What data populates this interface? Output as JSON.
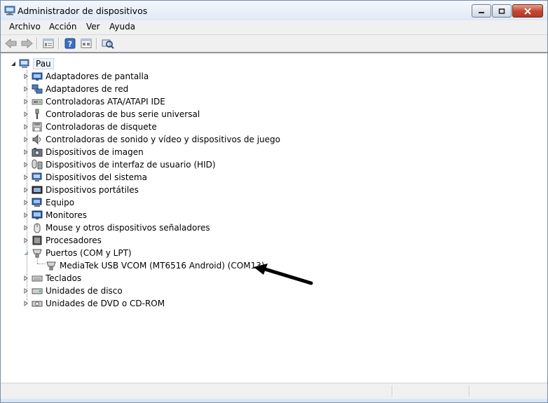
{
  "window": {
    "title": "Administrador de dispositivos",
    "controls": [
      "minimize",
      "maximize",
      "close"
    ]
  },
  "menu": [
    {
      "label": "Archivo"
    },
    {
      "label": "Acción"
    },
    {
      "label": "Ver"
    },
    {
      "label": "Ayuda"
    }
  ],
  "toolbar": {
    "icons": [
      "back-icon",
      "forward-icon",
      "properties-icon",
      "help-icon",
      "view-icon",
      "scan-hardware-icon"
    ]
  },
  "tree": {
    "root": {
      "label": "Pau",
      "expanded": true
    },
    "categories": [
      {
        "label": "Adaptadores de pantalla",
        "icon": "display-adapter-icon"
      },
      {
        "label": "Adaptadores de red",
        "icon": "network-adapter-icon"
      },
      {
        "label": "Controladoras ATA/ATAPI IDE",
        "icon": "ide-controller-icon"
      },
      {
        "label": "Controladoras de bus serie universal",
        "icon": "usb-icon"
      },
      {
        "label": "Controladoras de disquete",
        "icon": "floppy-icon"
      },
      {
        "label": "Controladoras de sonido y vídeo y dispositivos de juego",
        "icon": "sound-icon"
      },
      {
        "label": "Dispositivos de imagen",
        "icon": "camera-icon"
      },
      {
        "label": "Dispositivos de interfaz de usuario (HID)",
        "icon": "hid-icon"
      },
      {
        "label": "Dispositivos del sistema",
        "icon": "system-device-icon"
      },
      {
        "label": "Dispositivos portátiles",
        "icon": "portable-device-icon"
      },
      {
        "label": "Equipo",
        "icon": "computer-icon"
      },
      {
        "label": "Monitores",
        "icon": "monitor-icon"
      },
      {
        "label": "Mouse y otros dispositivos señaladores",
        "icon": "mouse-icon"
      },
      {
        "label": "Procesadores",
        "icon": "processor-icon"
      },
      {
        "label": "Puertos (COM y LPT)",
        "icon": "port-icon",
        "expanded": true,
        "children": [
          {
            "label": "MediaTek USB VCOM (MT6516 Android) (COM13)",
            "icon": "port-icon"
          }
        ]
      },
      {
        "label": "Teclados",
        "icon": "keyboard-icon"
      },
      {
        "label": "Unidades de disco",
        "icon": "disk-icon"
      },
      {
        "label": "Unidades de DVD o CD-ROM",
        "icon": "dvd-icon"
      }
    ]
  },
  "colors": {
    "accent": "#316ac5",
    "titlebar": "#dfe9f6",
    "arrow": "#000000"
  }
}
